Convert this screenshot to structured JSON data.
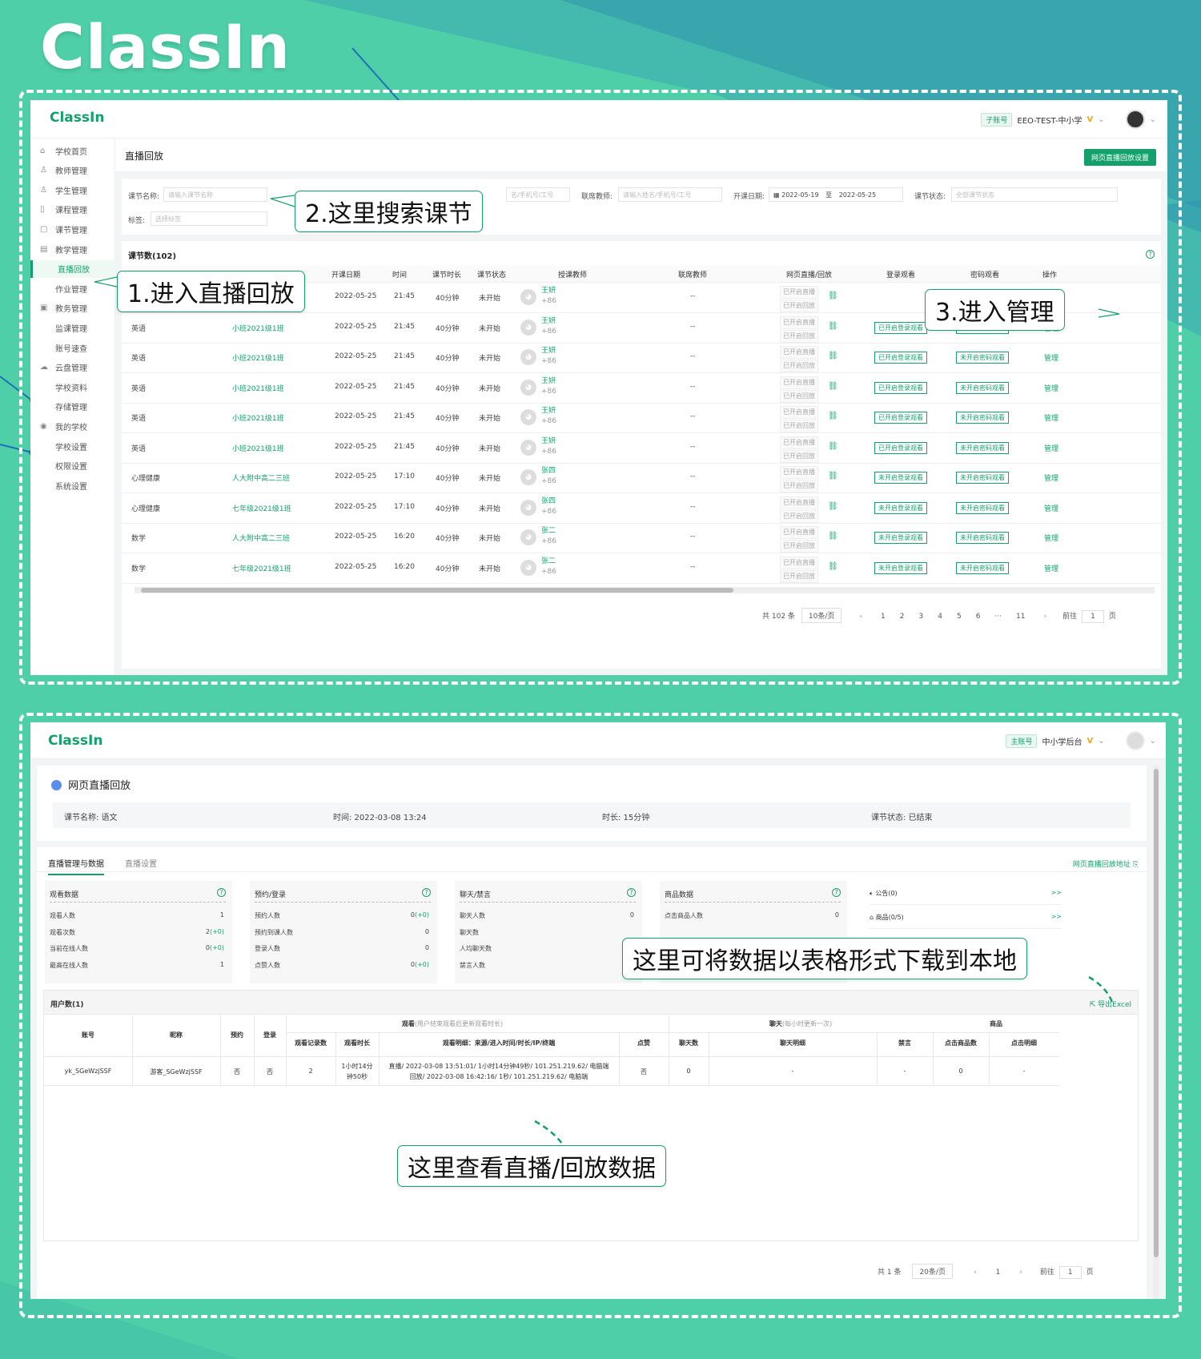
{
  "brand": "ClassIn",
  "panel1": {
    "logo": "ClassIn",
    "account_tag": "子账号",
    "account_name": "EEO-TEST-中小学",
    "vip": "V",
    "sidebar": [
      {
        "label": "学校首页",
        "icon": "⌂"
      },
      {
        "label": "教师管理",
        "icon": "♙"
      },
      {
        "label": "学生管理",
        "icon": "♙"
      },
      {
        "label": "课程管理",
        "icon": "▯"
      },
      {
        "label": "课节管理",
        "icon": "▢"
      },
      {
        "label": "教学管理",
        "icon": "▤"
      },
      {
        "label": "直播回放",
        "icon": ""
      },
      {
        "label": "作业管理",
        "icon": ""
      },
      {
        "label": "教务管理",
        "icon": "▣"
      },
      {
        "label": "监课管理",
        "icon": ""
      },
      {
        "label": "账号速查",
        "icon": ""
      },
      {
        "label": "云盘管理",
        "icon": "☁"
      },
      {
        "label": "学校资料",
        "icon": ""
      },
      {
        "label": "存储管理",
        "icon": ""
      },
      {
        "label": "我的学校",
        "icon": "◉"
      },
      {
        "label": "学校设置",
        "icon": ""
      },
      {
        "label": "权限设置",
        "icon": ""
      },
      {
        "label": "系统设置",
        "icon": ""
      }
    ],
    "page_title": "直播回放",
    "settings_button": "网页直播回放设置",
    "filters": {
      "lesson_name_label": "课节名称:",
      "lesson_name_placeholder": "请输入课节名称",
      "teacher_placeholder": "名/手机号/工号",
      "co_teacher_label": "联席教师:",
      "co_teacher_placeholder": "请输入姓名/手机号/工号",
      "date_label": "开课日期:",
      "date_start": "2022-05-19",
      "date_to": "至",
      "date_end": "2022-05-25",
      "status_label": "课节状态:",
      "status_placeholder": "全部课节状态",
      "tag_label": "标签:",
      "tag_placeholder": "选择标签"
    },
    "lesson_count": "课节数(102)",
    "headers": [
      "开课日期",
      "时间",
      "课节时长",
      "课节状态",
      "授课教师",
      "联席教师",
      "网页直播/回放",
      "登录观看",
      "密码观看",
      "操作"
    ],
    "rows": [
      {
        "name": "英语",
        "course": "英语",
        "date": "2022-05-25",
        "time": "21:45",
        "dur": "40分钟",
        "status": "未开始",
        "teacher": "王妍",
        "phone": "+86",
        "co": "--",
        "login": "",
        "pwd": ""
      },
      {
        "name": "英语",
        "course": "小班2021级1班",
        "date": "2022-05-25",
        "time": "21:45",
        "dur": "40分钟",
        "status": "未开始",
        "teacher": "王妍",
        "phone": "+86",
        "co": "--",
        "login": "已开启登录观看",
        "pwd": "未开启密码观看"
      },
      {
        "name": "英语",
        "course": "小班2021级1班",
        "date": "2022-05-25",
        "time": "21:45",
        "dur": "40分钟",
        "status": "未开始",
        "teacher": "王妍",
        "phone": "+86",
        "co": "--",
        "login": "已开启登录观看",
        "pwd": "未开启密码观看"
      },
      {
        "name": "英语",
        "course": "小班2021级1班",
        "date": "2022-05-25",
        "time": "21:45",
        "dur": "40分钟",
        "status": "未开始",
        "teacher": "王妍",
        "phone": "+86",
        "co": "--",
        "login": "已开启登录观看",
        "pwd": "未开启密码观看"
      },
      {
        "name": "英语",
        "course": "小班2021级1班",
        "date": "2022-05-25",
        "time": "21:45",
        "dur": "40分钟",
        "status": "未开始",
        "teacher": "王妍",
        "phone": "+86",
        "co": "--",
        "login": "已开启登录观看",
        "pwd": "未开启密码观看"
      },
      {
        "name": "英语",
        "course": "小班2021级1班",
        "date": "2022-05-25",
        "time": "21:45",
        "dur": "40分钟",
        "status": "未开始",
        "teacher": "王妍",
        "phone": "+86",
        "co": "--",
        "login": "已开启登录观看",
        "pwd": "未开启密码观看"
      },
      {
        "name": "心理健康",
        "course": "人大附中高二三班",
        "date": "2022-05-25",
        "time": "17:10",
        "dur": "40分钟",
        "status": "未开始",
        "teacher": "张四",
        "phone": "+86",
        "co": "--",
        "login": "未开启登录观看",
        "pwd": "未开启密码观看"
      },
      {
        "name": "心理健康",
        "course": "七年级2021级1班",
        "date": "2022-05-25",
        "time": "17:10",
        "dur": "40分钟",
        "status": "未开始",
        "teacher": "张四",
        "phone": "+86",
        "co": "--",
        "login": "未开启登录观看",
        "pwd": "未开启密码观看"
      },
      {
        "name": "数学",
        "course": "人大附中高二三班",
        "date": "2022-05-25",
        "time": "16:20",
        "dur": "40分钟",
        "status": "未开始",
        "teacher": "张二",
        "phone": "+86",
        "co": "--",
        "login": "未开启登录观看",
        "pwd": "未开启密码观看"
      },
      {
        "name": "数学",
        "course": "七年级2021级1班",
        "date": "2022-05-25",
        "time": "16:20",
        "dur": "40分钟",
        "status": "未开始",
        "teacher": "张二",
        "phone": "+86",
        "co": "--",
        "login": "未开启登录观看",
        "pwd": "未开启密码观看"
      }
    ],
    "live_on": "已开启直播",
    "replay_on": "已开启回放",
    "manage": "管理",
    "pager": {
      "total": "共 102 条",
      "size": "10条/页",
      "pages": [
        "1",
        "2",
        "3",
        "4",
        "5",
        "6",
        "···",
        "11"
      ],
      "goto": "前往",
      "page": "1",
      "unit": "页"
    },
    "callouts": {
      "step1": "1.进入直播回放",
      "step2": "2.这里搜索课节",
      "step3": "3.进入管理"
    }
  },
  "panel2": {
    "logo": "ClassIn",
    "account_tag": "主账号",
    "account_name": "中小学后台",
    "vip": "V",
    "title": "网页直播回放",
    "info": {
      "name": "课节名称: 语文",
      "time": "时间: 2022-03-08 13:24",
      "dur": "时长: 15分钟",
      "status": "课节状态: 已结束"
    },
    "tabs": [
      "直播管理与数据",
      "直播设置"
    ],
    "replay_link": "网页直播回放地址",
    "stats": [
      {
        "title": "观看数据",
        "rows": [
          [
            "观看人数",
            "1",
            ""
          ],
          [
            "观看次数",
            "2",
            "(+0)"
          ],
          [
            "当前在线人数",
            "0",
            "(+0)"
          ],
          [
            "最高在线人数",
            "1",
            ""
          ]
        ]
      },
      {
        "title": "预约/登录",
        "rows": [
          [
            "预约人数",
            "0",
            "(+0)"
          ],
          [
            "预约到课人数",
            "0",
            ""
          ],
          [
            "登录人数",
            "0",
            ""
          ],
          [
            "点赞人数",
            "0",
            "(+0)"
          ]
        ]
      },
      {
        "title": "聊天/禁言",
        "rows": [
          [
            "聊天人数",
            "0",
            ""
          ],
          [
            "聊天数",
            "",
            ""
          ],
          [
            "人均聊天数",
            "",
            ""
          ],
          [
            "禁言人数",
            "0",
            ""
          ]
        ]
      },
      {
        "title": "商品数据",
        "rows": [
          [
            "点击商品人数",
            "0",
            ""
          ]
        ]
      }
    ],
    "notice": "公告(0)",
    "goods": "商品(0/5)",
    "more": ">>",
    "user_count": "用户数(1)",
    "export": "导出Excel",
    "group_watch": "观看",
    "group_watch_note": "(用户结束观看后更新观看时长)",
    "group_chat": "聊天",
    "group_chat_note": "(每小时更新一次)",
    "group_goods": "商品",
    "cols": [
      "账号",
      "昵称",
      "预约",
      "登录",
      "观看记录数",
      "观看时长",
      "观看明细：来源/进入时间/时长/IP/终端",
      "点赞",
      "聊天数",
      "聊天明细",
      "禁言",
      "点击商品数",
      "点击明细"
    ],
    "user": {
      "account": "yk_SGeWzjSSF",
      "nick": "游客_SGeWzjSSF",
      "reserve": "否",
      "login": "否",
      "records": "2",
      "dur1": "1小时14分",
      "dur2": "钟50秒",
      "detail1": "直播/ 2022-03-08 13:51:01/ 1小时14分钟49秒/ 101.251.219.62/ 电脑端",
      "detail2": "回放/ 2022-03-08 16:42:16/ 1秒/ 101.251.219.62/ 电脑端",
      "like": "否",
      "chats": "0",
      "chat_detail": "-",
      "mute": "-",
      "clicks": "0",
      "click_detail": "-"
    },
    "pager": {
      "total": "共 1 条",
      "size": "20条/页",
      "page": "1",
      "goto": "前往",
      "box": "1",
      "unit": "页"
    },
    "callouts": {
      "download": "这里可将数据以表格形式下载到本地",
      "view": "这里查看直播/回放数据"
    }
  }
}
